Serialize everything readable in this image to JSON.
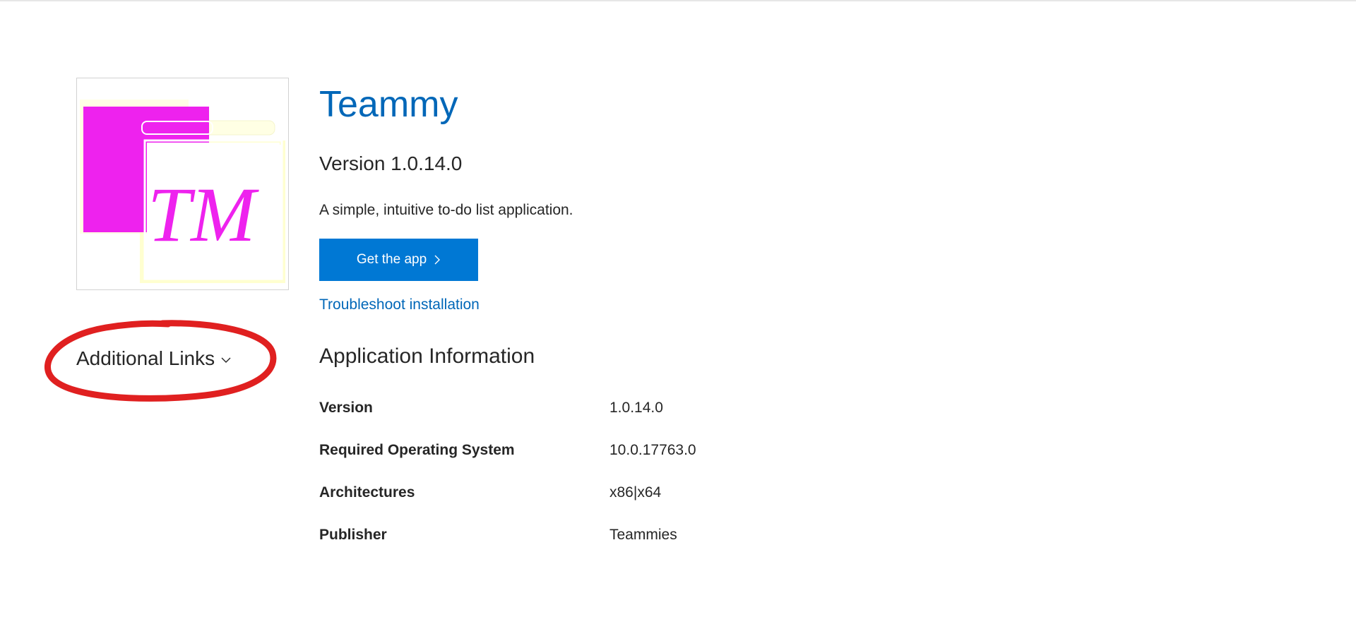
{
  "app": {
    "title": "Teammy",
    "version_line": "Version 1.0.14.0",
    "description": "A simple, intuitive to-do list application.",
    "logo_text": "TM",
    "get_app_label": "Get the app",
    "troubleshoot_label": "Troubleshoot installation"
  },
  "sidebar": {
    "additional_links_label": "Additional Links",
    "annotation": "red hand-drawn circle around Additional Links"
  },
  "info": {
    "section_title": "Application Information",
    "rows": [
      {
        "key": "Version",
        "value": "1.0.14.0"
      },
      {
        "key": "Required Operating System",
        "value": "10.0.17763.0"
      },
      {
        "key": "Architectures",
        "value": "x86|x64"
      },
      {
        "key": "Publisher",
        "value": "Teammies"
      }
    ]
  },
  "colors": {
    "title_blue": "#0067b8",
    "button_blue": "#0078d4",
    "logo_magenta": "#ee22ee",
    "logo_pale_yellow": "#ffffe0",
    "annotation_red": "#e02020"
  }
}
